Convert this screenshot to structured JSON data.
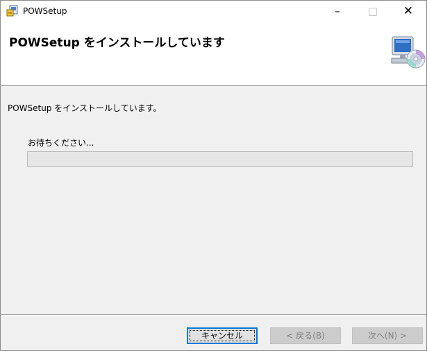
{
  "window": {
    "title": "POWSetup",
    "controls": {
      "minimize": "–",
      "maximize": "□",
      "close": "✕"
    }
  },
  "banner": {
    "title": "POWSetup をインストールしています"
  },
  "main": {
    "status_text": "POWSetup をインストールしています。",
    "wait_text": "お待ちください...",
    "progress": 0
  },
  "footer": {
    "cancel_label": "キャンセル",
    "back_label": "< 戻る(B)",
    "next_label": "次へ(N) >"
  },
  "colors": {
    "progress_fill": "#06b025",
    "dialog_background": "#f0f0f0",
    "default_button_border": "#0078d7"
  },
  "icons": {
    "app": "installer-icon",
    "banner": "computer-cd-icon"
  }
}
